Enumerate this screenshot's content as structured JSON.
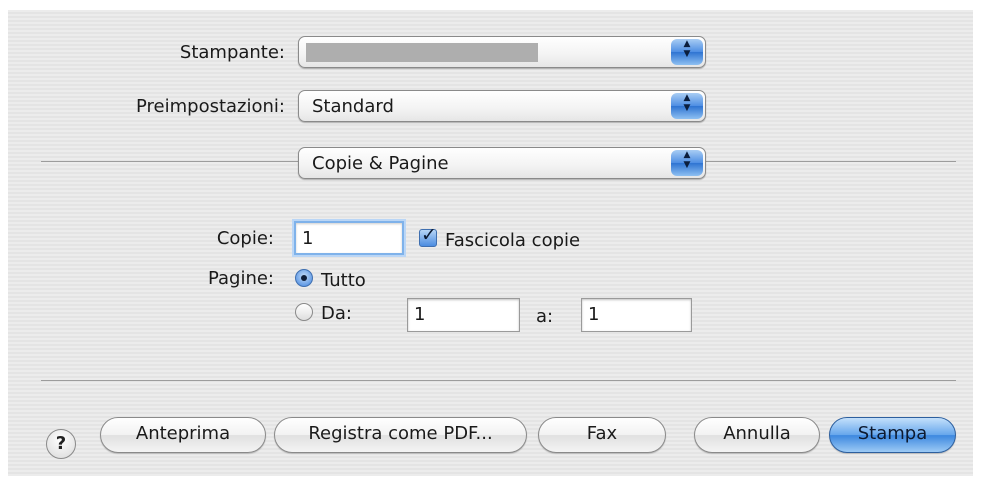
{
  "printer": {
    "label": "Stampante:",
    "value": ""
  },
  "presets": {
    "label": "Preimpostazioni:",
    "value": "Standard"
  },
  "panel": {
    "value": "Copie & Pagine"
  },
  "copies": {
    "label": "Copie:",
    "value": "1",
    "collate_label": "Fascicola copie",
    "collate_checked": true
  },
  "pages": {
    "label": "Pagine:",
    "all_label": "Tutto",
    "all_selected": true,
    "from_label": "Da:",
    "from_value": "1",
    "to_label": "a:",
    "to_value": "1"
  },
  "buttons": {
    "help": "?",
    "preview": "Anteprima",
    "save_pdf": "Registra come PDF...",
    "fax": "Fax",
    "cancel": "Annulla",
    "print": "Stampa"
  },
  "icons": {
    "popup_arrows": "up-down-arrows-icon",
    "checkbox": "checkmark-icon",
    "help": "question-mark-icon"
  },
  "colors": {
    "accent": "#3c87df",
    "background": "#ececec"
  }
}
